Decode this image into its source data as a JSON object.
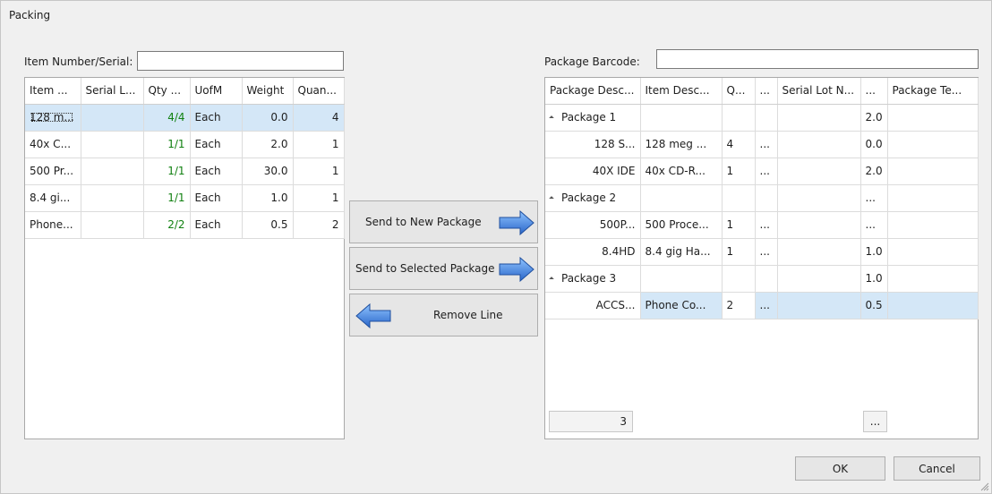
{
  "window": {
    "title": "Packing"
  },
  "left": {
    "search_label": "Item Number/Serial:",
    "search_value": "",
    "columns": [
      "Item ...",
      "Serial L...",
      "Qty ...",
      "UofM",
      "Weight",
      "Quan..."
    ],
    "rows": [
      {
        "item": "128 m...",
        "serial": "",
        "qty": "4/4",
        "uofm": "Each",
        "weight": "0.0",
        "quantity": "4"
      },
      {
        "item": "40x C...",
        "serial": "",
        "qty": "1/1",
        "uofm": "Each",
        "weight": "2.0",
        "quantity": "1"
      },
      {
        "item": "500 Pr...",
        "serial": "",
        "qty": "1/1",
        "uofm": "Each",
        "weight": "30.0",
        "quantity": "1"
      },
      {
        "item": "8.4 gi...",
        "serial": "",
        "qty": "1/1",
        "uofm": "Each",
        "weight": "1.0",
        "quantity": "1"
      },
      {
        "item": "Phone...",
        "serial": "",
        "qty": "2/2",
        "uofm": "Each",
        "weight": "0.5",
        "quantity": "2"
      }
    ]
  },
  "buttons": {
    "send_new": "Send to New Package",
    "send_selected": "Send to Selected Package",
    "remove": "Remove Line"
  },
  "right": {
    "barcode_label": "Package Barcode:",
    "barcode_value": "",
    "columns": [
      "Package Desc...",
      "Item Desc...",
      "Q...",
      "...",
      "Serial Lot N...",
      "...",
      "Package Te..."
    ],
    "rows": [
      {
        "pkg": "Package 1",
        "desc": "",
        "q": "",
        "c4": "",
        "lot": "",
        "c6": "2.0",
        "te": "",
        "group": true
      },
      {
        "pkg": "128 S...",
        "desc": "128 meg ...",
        "q": "4",
        "c4": "...",
        "lot": "",
        "c6": "0.0",
        "te": "",
        "group": false
      },
      {
        "pkg": "40X IDE",
        "desc": "40x CD-R...",
        "q": "1",
        "c4": "...",
        "lot": "",
        "c6": "2.0",
        "te": "",
        "group": false
      },
      {
        "pkg": "Package 2",
        "desc": "",
        "q": "",
        "c4": "",
        "lot": "",
        "c6": "...",
        "te": "",
        "group": true
      },
      {
        "pkg": "500P...",
        "desc": "500 Proce...",
        "q": "1",
        "c4": "...",
        "lot": "",
        "c6": "...",
        "te": "",
        "group": false
      },
      {
        "pkg": "8.4HD",
        "desc": "8.4 gig Ha...",
        "q": "1",
        "c4": "...",
        "lot": "",
        "c6": "1.0",
        "te": "",
        "group": false
      },
      {
        "pkg": "Package 3",
        "desc": "",
        "q": "",
        "c4": "",
        "lot": "",
        "c6": "1.0",
        "te": "",
        "group": true
      },
      {
        "pkg": "ACCS...",
        "desc": "Phone Co...",
        "q": "2",
        "c4": "...",
        "lot": "",
        "c6": "0.5",
        "te": "",
        "group": false
      }
    ],
    "footer_count": "3",
    "footer_more": "..."
  },
  "actions": {
    "ok": "OK",
    "cancel": "Cancel"
  },
  "colors": {
    "selected_row": "#d4e7f7",
    "qty_text": "#108010",
    "arrow": "#3f7fd9"
  }
}
